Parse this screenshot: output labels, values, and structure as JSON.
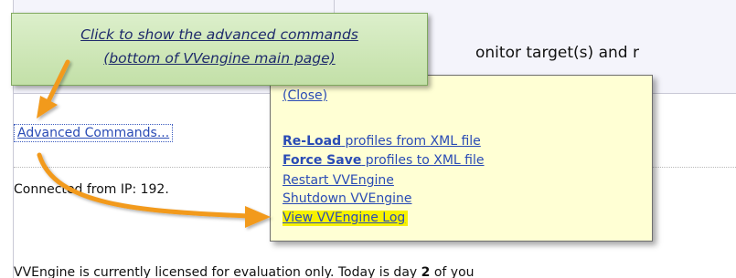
{
  "callout": {
    "line1": "Click to show the advanced commands",
    "line2": "(bottom of VVengine main page)"
  },
  "header": {
    "monitor_text": "onitor target(s) and r"
  },
  "page": {
    "advanced_commands_link": "Advanced Commands...",
    "connected_text": "Connected from IP: 192.",
    "license_text_prefix": "VVEngine is currently licensed for evaluation only.  Today is day ",
    "license_day": "2",
    "license_text_suffix": " of you"
  },
  "popup": {
    "close_label": "(Close)",
    "reload_bold": "Re-Load",
    "reload_rest": " profiles from XML file",
    "forcesave_bold": "Force Save",
    "forcesave_rest": " profiles to XML file",
    "restart_label": "Restart VVEngine",
    "shutdown_label": "Shutdown VVEngine",
    "viewlog_label": "View VVEngine Log"
  },
  "colors": {
    "link": "#2a4bb5",
    "popup_bg": "#ffffd4",
    "highlight": "#f7f200",
    "callout_bg": "#c3e0a8",
    "arrow": "#f29a1f"
  },
  "icons": {
    "callout_arrow": "arrow-down-left-icon",
    "log_arrow": "curved-arrow-right-icon"
  }
}
